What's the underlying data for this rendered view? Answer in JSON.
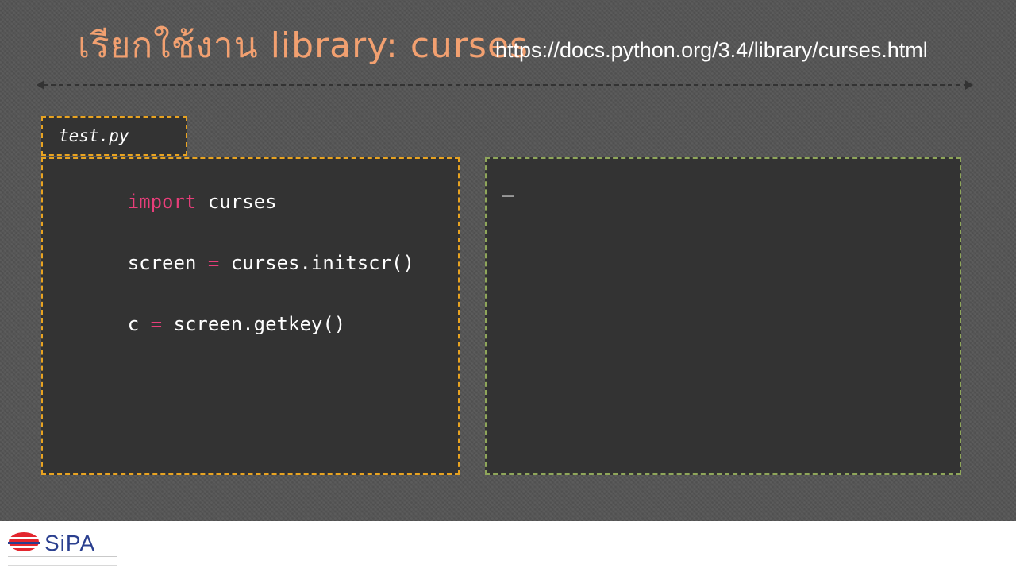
{
  "slide": {
    "title": "เรียกใช้งาน library: curses",
    "doc_url": "https://docs.python.org/3.4/library/curses.html"
  },
  "editor": {
    "file_tab": "test.py",
    "code": [
      {
        "parts": [
          {
            "t": "import",
            "c": "kw"
          },
          {
            "t": " curses",
            "c": ""
          }
        ]
      },
      {
        "parts": [
          {
            "t": "screen ",
            "c": ""
          },
          {
            "t": "=",
            "c": "op"
          },
          {
            "t": " curses.initscr()",
            "c": ""
          }
        ]
      },
      {
        "parts": [
          {
            "t": "c ",
            "c": ""
          },
          {
            "t": "=",
            "c": "op"
          },
          {
            "t": " screen.getkey()",
            "c": ""
          }
        ]
      }
    ]
  },
  "terminal": {
    "cursor": "_"
  },
  "footer": {
    "logo_text": "SiPA"
  },
  "colors": {
    "title": "#f2a070",
    "keyword": "#e83e7a",
    "editor_border": "#e8a321",
    "terminal_border": "#8fa65a",
    "logo_red": "#e3262e",
    "logo_blue": "#2a3f8f"
  }
}
